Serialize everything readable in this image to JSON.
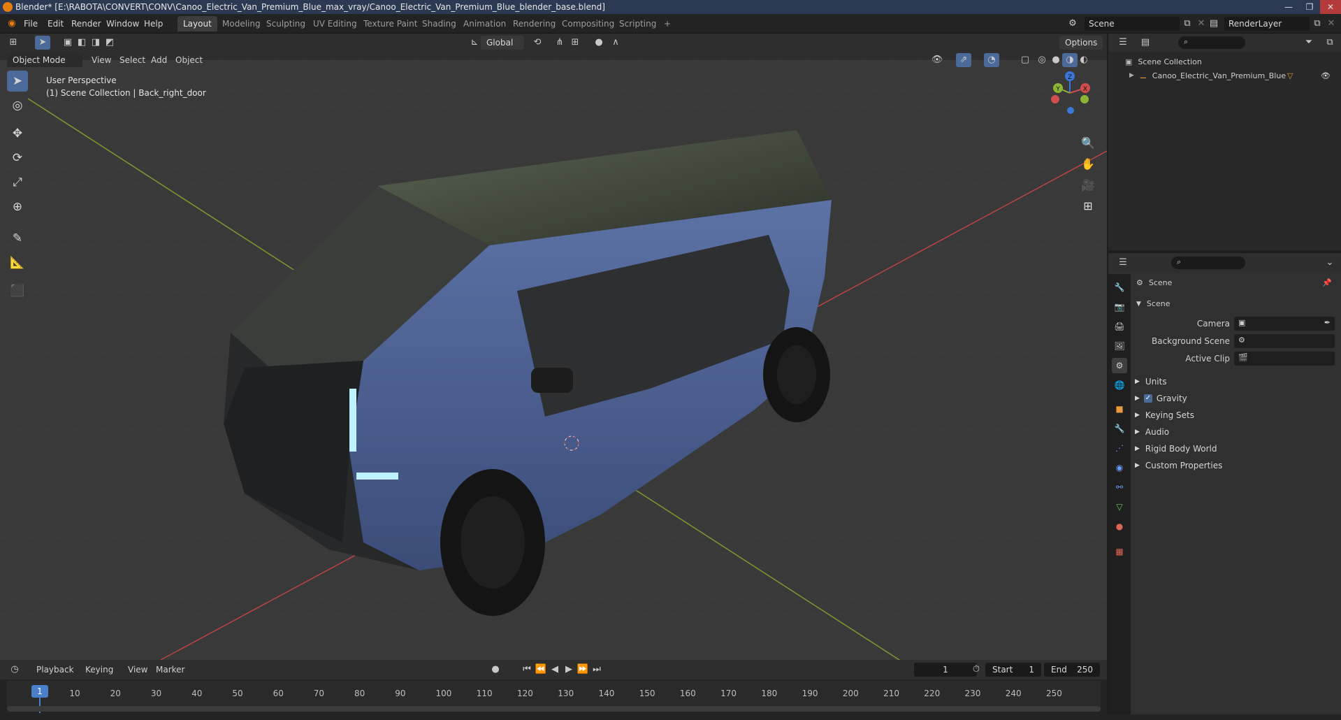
{
  "window": {
    "title": "Blender* [E:\\RABOTA\\CONVERT\\CONV\\Canoo_Electric_Van_Premium_Blue_max_vray/Canoo_Electric_Van_Premium_Blue_blender_base.blend]",
    "minimize": "—",
    "maximize": "❐",
    "close": "✕"
  },
  "menu": [
    "File",
    "Edit",
    "Render",
    "Window",
    "Help"
  ],
  "workspaces": [
    "Layout",
    "Modeling",
    "Sculpting",
    "UV Editing",
    "Texture Paint",
    "Shading",
    "Animation",
    "Rendering",
    "Compositing",
    "Scripting"
  ],
  "workspace_add": "+",
  "scene_field": "Scene",
  "renderlayer_field": "RenderLayer",
  "toolbar_header": {
    "orientation": "Global",
    "options": "Options"
  },
  "viewport_header": {
    "mode": "Object Mode",
    "menus": [
      "View",
      "Select",
      "Add",
      "Object"
    ]
  },
  "viewport": {
    "perspective": "User Perspective",
    "collection_info": "(1) Scene Collection | Back_right_door",
    "gizmo": {
      "x": "X",
      "y": "Y",
      "z": "Z"
    }
  },
  "outliner": {
    "root": "Scene Collection",
    "items": [
      {
        "label": "Canoo_Electric_Van_Premium_Blue"
      }
    ]
  },
  "properties": {
    "context": "Scene",
    "section": "Scene",
    "fields": [
      {
        "label": "Camera",
        "value": ""
      },
      {
        "label": "Background Scene",
        "value": ""
      },
      {
        "label": "Active Clip",
        "value": ""
      }
    ],
    "panels": [
      {
        "label": "Units",
        "checkbox": false
      },
      {
        "label": "Gravity",
        "checkbox": true
      },
      {
        "label": "Keying Sets",
        "checkbox": false
      },
      {
        "label": "Audio",
        "checkbox": false
      },
      {
        "label": "Rigid Body World",
        "checkbox": false
      },
      {
        "label": "Custom Properties",
        "checkbox": false
      }
    ]
  },
  "timeline": {
    "menus": [
      "Playback",
      "Keying",
      "View",
      "Marker"
    ],
    "current_frame": "1",
    "start_label": "Start",
    "start": "1",
    "end_label": "End",
    "end": "250",
    "ticks": [
      "1",
      "10",
      "20",
      "30",
      "40",
      "50",
      "60",
      "70",
      "80",
      "90",
      "100",
      "110",
      "120",
      "130",
      "140",
      "150",
      "160",
      "170",
      "180",
      "190",
      "200",
      "210",
      "220",
      "230",
      "240",
      "250"
    ]
  },
  "colors": {
    "accent": "#4b6a99",
    "x_axis": "#d14d4d",
    "y_axis": "#8db534",
    "z_axis": "#3b77d9",
    "van_blue": "#4a5f90",
    "frame_marker": "#4a7fc9"
  }
}
